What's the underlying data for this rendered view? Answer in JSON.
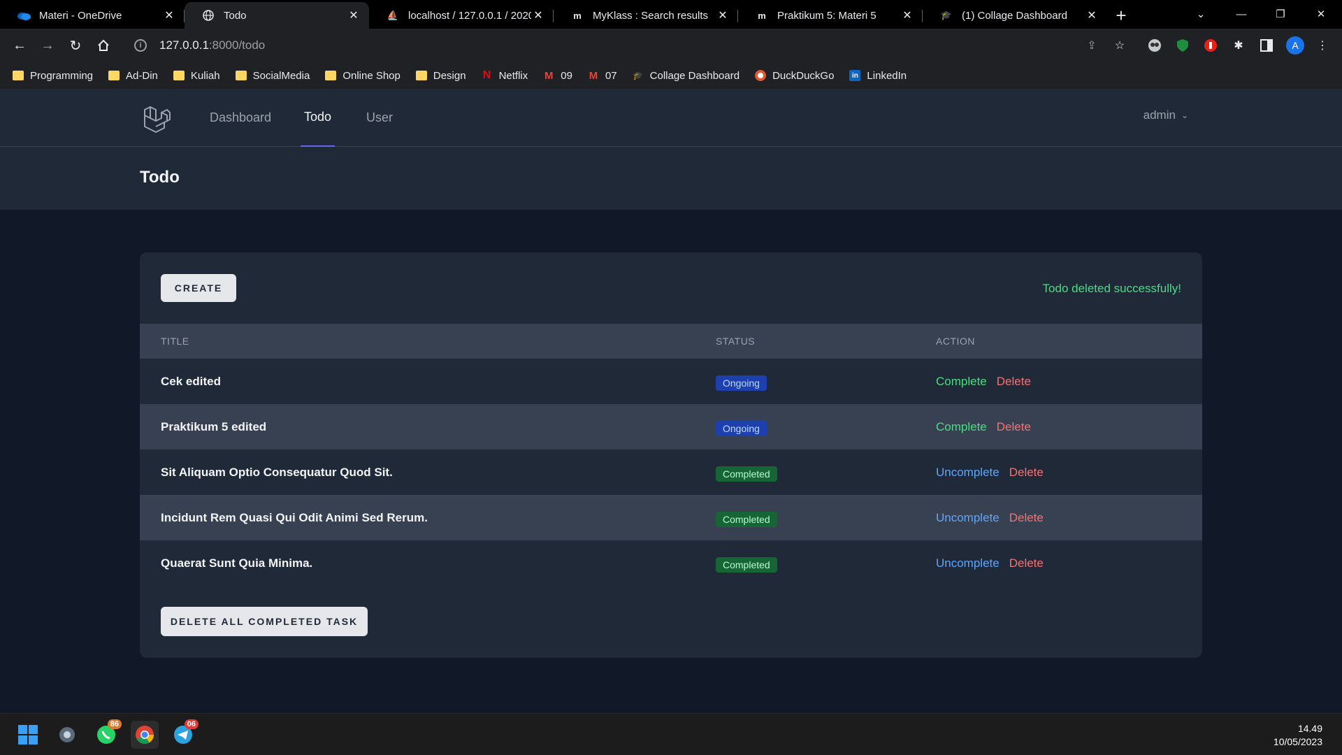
{
  "browser": {
    "tabs": [
      {
        "title": "Materi - OneDrive",
        "icon": "onedrive-icon",
        "active": false
      },
      {
        "title": "Todo",
        "icon": "globe-icon",
        "active": true
      },
      {
        "title": "localhost / 127.0.0.1 / 2020(",
        "icon": "phpmyadmin-icon",
        "active": false
      },
      {
        "title": "MyKlass : Search results",
        "icon": "myklass-icon",
        "active": false
      },
      {
        "title": "Praktikum 5: Materi 5",
        "icon": "myklass-icon",
        "active": false
      },
      {
        "title": "(1) Collage Dashboard",
        "icon": "mortarboard-icon",
        "active": false
      }
    ],
    "url_host": "127.0.0.1",
    "url_path": ":8000/todo",
    "bookmarks": [
      {
        "label": "Programming",
        "icon": "folder"
      },
      {
        "label": "Ad-Din",
        "icon": "folder"
      },
      {
        "label": "Kuliah",
        "icon": "folder"
      },
      {
        "label": "SocialMedia",
        "icon": "folder"
      },
      {
        "label": "Online Shop",
        "icon": "folder"
      },
      {
        "label": "Design",
        "icon": "folder"
      },
      {
        "label": "Netflix",
        "icon": "netflix-icon"
      },
      {
        "label": "09",
        "icon": "gmail-icon"
      },
      {
        "label": "07",
        "icon": "gmail-icon"
      },
      {
        "label": "Collage Dashboard",
        "icon": "mortarboard-icon"
      },
      {
        "label": "DuckDuckGo",
        "icon": "duckduckgo-icon"
      },
      {
        "label": "LinkedIn",
        "icon": "linkedin-icon"
      }
    ],
    "profile_initial": "A"
  },
  "nav": {
    "links": [
      "Dashboard",
      "Todo",
      "User"
    ],
    "active": "Todo",
    "user": "admin"
  },
  "page": {
    "title": "Todo",
    "create_label": "CREATE",
    "flash_message": "Todo deleted successfully!",
    "columns": [
      "TITLE",
      "STATUS",
      "ACTION"
    ],
    "rows": [
      {
        "title": "Cek edited",
        "status": "Ongoing",
        "primary_action": "Complete",
        "delete": "Delete"
      },
      {
        "title": "Praktikum 5 edited",
        "status": "Ongoing",
        "primary_action": "Complete",
        "delete": "Delete"
      },
      {
        "title": "Sit Aliquam Optio Consequatur Quod Sit.",
        "status": "Completed",
        "primary_action": "Uncomplete",
        "delete": "Delete"
      },
      {
        "title": "Incidunt Rem Quasi Qui Odit Animi Sed Rerum.",
        "status": "Completed",
        "primary_action": "Uncomplete",
        "delete": "Delete"
      },
      {
        "title": "Quaerat Sunt Quia Minima.",
        "status": "Completed",
        "primary_action": "Uncomplete",
        "delete": "Delete"
      }
    ],
    "delete_completed_label": "DELETE ALL COMPLETED TASK"
  },
  "taskbar": {
    "whatsapp_badge": "86",
    "telegram_badge": "06",
    "time": "14.49",
    "date": "10/05/2023"
  }
}
